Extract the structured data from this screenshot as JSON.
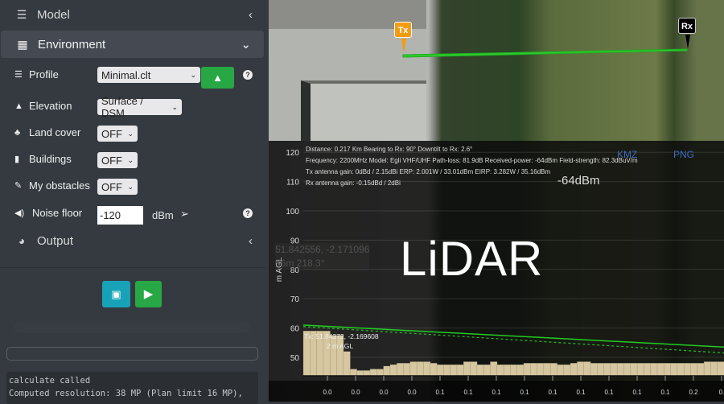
{
  "sidebar": {
    "model_label": "Model",
    "environment_label": "Environment",
    "output_label": "Output",
    "rows": {
      "profile": {
        "label": "Profile",
        "value": "Minimal.clt"
      },
      "elevation": {
        "label": "Elevation",
        "value": "Surface / DSM"
      },
      "land_cover": {
        "label": "Land cover",
        "value": "OFF"
      },
      "buildings": {
        "label": "Buildings",
        "value": "OFF"
      },
      "obstacles": {
        "label": "My obstacles",
        "value": "OFF"
      },
      "noise": {
        "label": "Noise floor",
        "value": "-120",
        "unit": "dBm"
      }
    },
    "help": "?",
    "log": [
      "calculate called",
      "Computed resolution: 38 MP (Plan limit 16 MP),"
    ]
  },
  "map": {
    "tx_label": "Tx",
    "rx_label": "Rx",
    "tooltip": [
      "51.842556, -2.171096",
      "66m 218.3°"
    ],
    "tx_info": [
      "Tx: 51.84372, -2.169608",
      "2 m AGL"
    ]
  },
  "chart_header": {
    "lines": [
      "Distance: 0.217 Km Bearing to Rx: 90° Downtilt to Rx: 2.6°",
      "Frequency: 2200MHz  Model: Egli VHF/UHF  Path-loss: 81.9dB  Received-power: -64dBm  Field-strength: 82.3dBuV/m",
      "Tx antenna gain: 0dBd / 2.15dBi  ERP: 2.001W / 33.01dBm  EIRP: 3.282W / 35.16dBm",
      "Rx antenna gain: -0.15dBd / 2dBi"
    ],
    "kmz": "KMZ",
    "png": "PNG",
    "power": "-64dBm",
    "watermark": "LiDAR"
  },
  "colors": {
    "accent_green": "#28a745",
    "accent_teal": "#17a2b8",
    "link_blue": "#3b6cc0",
    "terrain": "#d6c7a0",
    "los": "#22cc22"
  },
  "chart_data": {
    "type": "area",
    "ylabel": "m AGL",
    "ylim": [
      45,
      125
    ],
    "yticks": [
      50,
      60,
      70,
      80,
      90,
      100,
      110,
      120
    ],
    "xtick_labels": [
      "0.0",
      "0.0",
      "0.0",
      "0.0",
      "0.1",
      "0.1",
      "0.1",
      "0.1",
      "0.1",
      "0.1",
      "0.1",
      "0.1",
      "0.1",
      "0.2",
      "0."
    ],
    "terrain": [
      59,
      59,
      59,
      59,
      57.5,
      57.5,
      52,
      46,
      45.5,
      45.5,
      46,
      46,
      47,
      47.5,
      48,
      48,
      48.5,
      48.5,
      48.5,
      48,
      47.5,
      47.5,
      47.5,
      47.5,
      48.5,
      48.5,
      47.5,
      47.5,
      48.5,
      47.5,
      47.5,
      47.5,
      47.5,
      48,
      48,
      48,
      48,
      48,
      47.5,
      47.5,
      48,
      48.5,
      48.5,
      48,
      48,
      48,
      48,
      48,
      48,
      48,
      48,
      48,
      48,
      48,
      48,
      48,
      48,
      48,
      48,
      48,
      48.5,
      48.5,
      48.5
    ],
    "line_of_sight": [
      61,
      53.5
    ],
    "fresnel_lower": [
      60.5,
      51.5
    ]
  }
}
